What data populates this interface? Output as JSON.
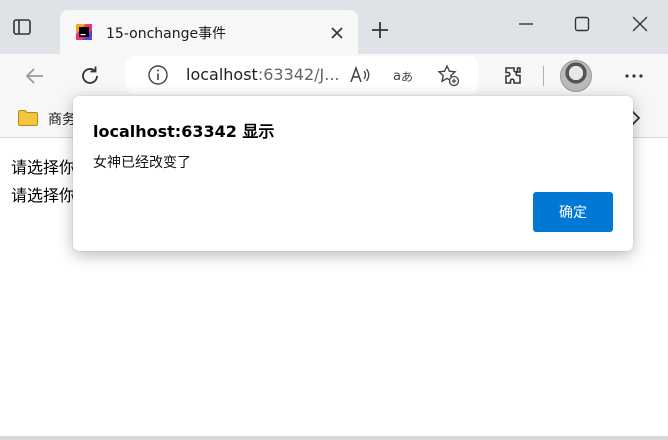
{
  "browser": {
    "tab": {
      "title": "15-onchange事件",
      "favicon": "webstorm-icon"
    },
    "address": {
      "host": "localhost",
      "rest": ":63342/J..."
    },
    "bookmarks": {
      "folder_label": "商务"
    }
  },
  "page": {
    "lines": [
      "请选择你",
      "请选择你"
    ]
  },
  "dialog": {
    "title": "localhost:63342 显示",
    "message": "女神已经改变了",
    "ok_label": "确定"
  },
  "colors": {
    "accent": "#0078d4",
    "tabstrip": "#dfe3e8",
    "toolbar": "#f7f7f7"
  }
}
